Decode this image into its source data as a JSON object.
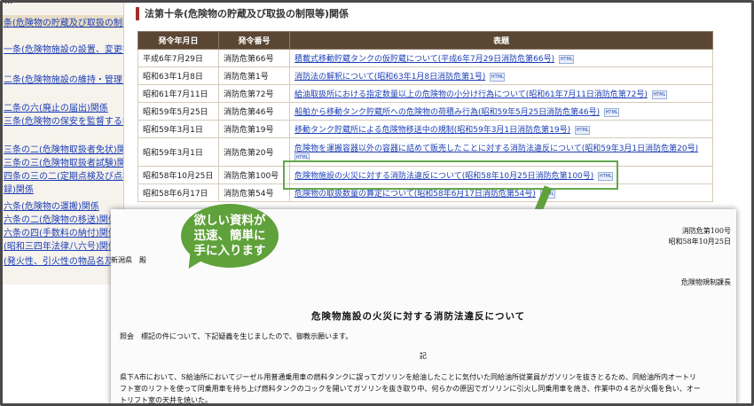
{
  "sidebar": {
    "header": "...",
    "items": [
      "条(危険物の貯蔵及び取扱の制限",
      "一条(危険物施設の設置、変更等)",
      "二条(危険物施設の維持・管理)関",
      "二条の六(廃止の届出)関係",
      "三条(危険物の保安を監督する者)",
      "三条の二(危険物取扱者免状)関係",
      "三条の三(危険物取扱者試験)関係",
      "四条の三の二(定期点検及び点検",
      "録)関係",
      "六条(危険物の運搬)関係",
      "六条の二(危険物の移送)関係",
      "六条の四(手数料の納付)関係",
      "(昭和三四年法律八六号)関係",
      "(発火性、引火性の物品名及び数"
    ]
  },
  "main": {
    "section_title": "法第十条(危険物の貯蔵及び取扱の制限等)関係",
    "columns": [
      "発令年月日",
      "発令番号",
      "表題"
    ],
    "rows": [
      {
        "date": "平成6年7月29日",
        "number": "消防危第66号",
        "title": "積載式移動貯蔵タンクの仮貯蔵について(平成6年7月29日消防危第66号)"
      },
      {
        "date": "昭和63年1月8日",
        "number": "消防危第1号",
        "title": "消防法の解釈について(昭和63年1月8日消防危第1号)"
      },
      {
        "date": "昭和61年7月11日",
        "number": "消防危第72号",
        "title": "給油取扱所における指定数量以上の危険物の小分け行為について(昭和61年7月11日消防危第72号)"
      },
      {
        "date": "昭和59年5月25日",
        "number": "消防危第46号",
        "title": "船舶から移動タンク貯蔵所への危険物の荷積み行為(昭和59年5月25日消防危第46号)"
      },
      {
        "date": "昭和59年3月1日",
        "number": "消防危第19号",
        "title": "移動タンク貯蔵所による危険物移送中の規制(昭和59年3月1日消防危第19号)"
      },
      {
        "date": "昭和59年3月1日",
        "number": "消防危第20号",
        "title": "危険物を運搬容器以外の容器に詰めて販売したことに対する消防法違反について(昭和59年3月1日消防危第20号)"
      },
      {
        "date": "昭和58年10月25日",
        "number": "消防危第100号",
        "title": "危険物施設の火災に対する消防法違反について(昭和58年10月25日消防危第100号)"
      },
      {
        "date": "昭和58年6月17日",
        "number": "消防危第54号",
        "title": "危険物の取扱数量の算定について(昭和58年6月17日消防危第54号)"
      }
    ],
    "html_icon": "HTML"
  },
  "bubble": {
    "lines": [
      "欲しい資料が",
      "迅速、簡単に",
      "手に入ります"
    ]
  },
  "document": {
    "number": "消防危第100号",
    "date": "昭和58年10月25日",
    "to": "新潟県　殿",
    "from": "危険物規制課長",
    "title": "危険物施設の火災に対する消防法違反について",
    "inquiry": "照会　標記の件について、下記疑義を生じましたので、御教示願います。",
    "ki": "記",
    "body_lines": [
      "県下A市において、S給油所においてジーゼル用普通乗用車の燃料タンクに誤ってガソリンを給油したことに気付いた同給油所従業員がガソリンを抜きとるため、同給油所内オートリ",
      "フト室のリフトを使って同乗用車を持ち上げ燃料タンクのコックを開いてガソリンを抜き取り中、何らかの原因でガソリンに引火し同乗用車を焼き、作業中の４名が火傷を負い、オー",
      "トリフト室の天井を焼いた。"
    ]
  },
  "colors": {
    "table_header": "#5a4632",
    "accent_green": "#5fa13a",
    "link": "#1c3fb5"
  }
}
